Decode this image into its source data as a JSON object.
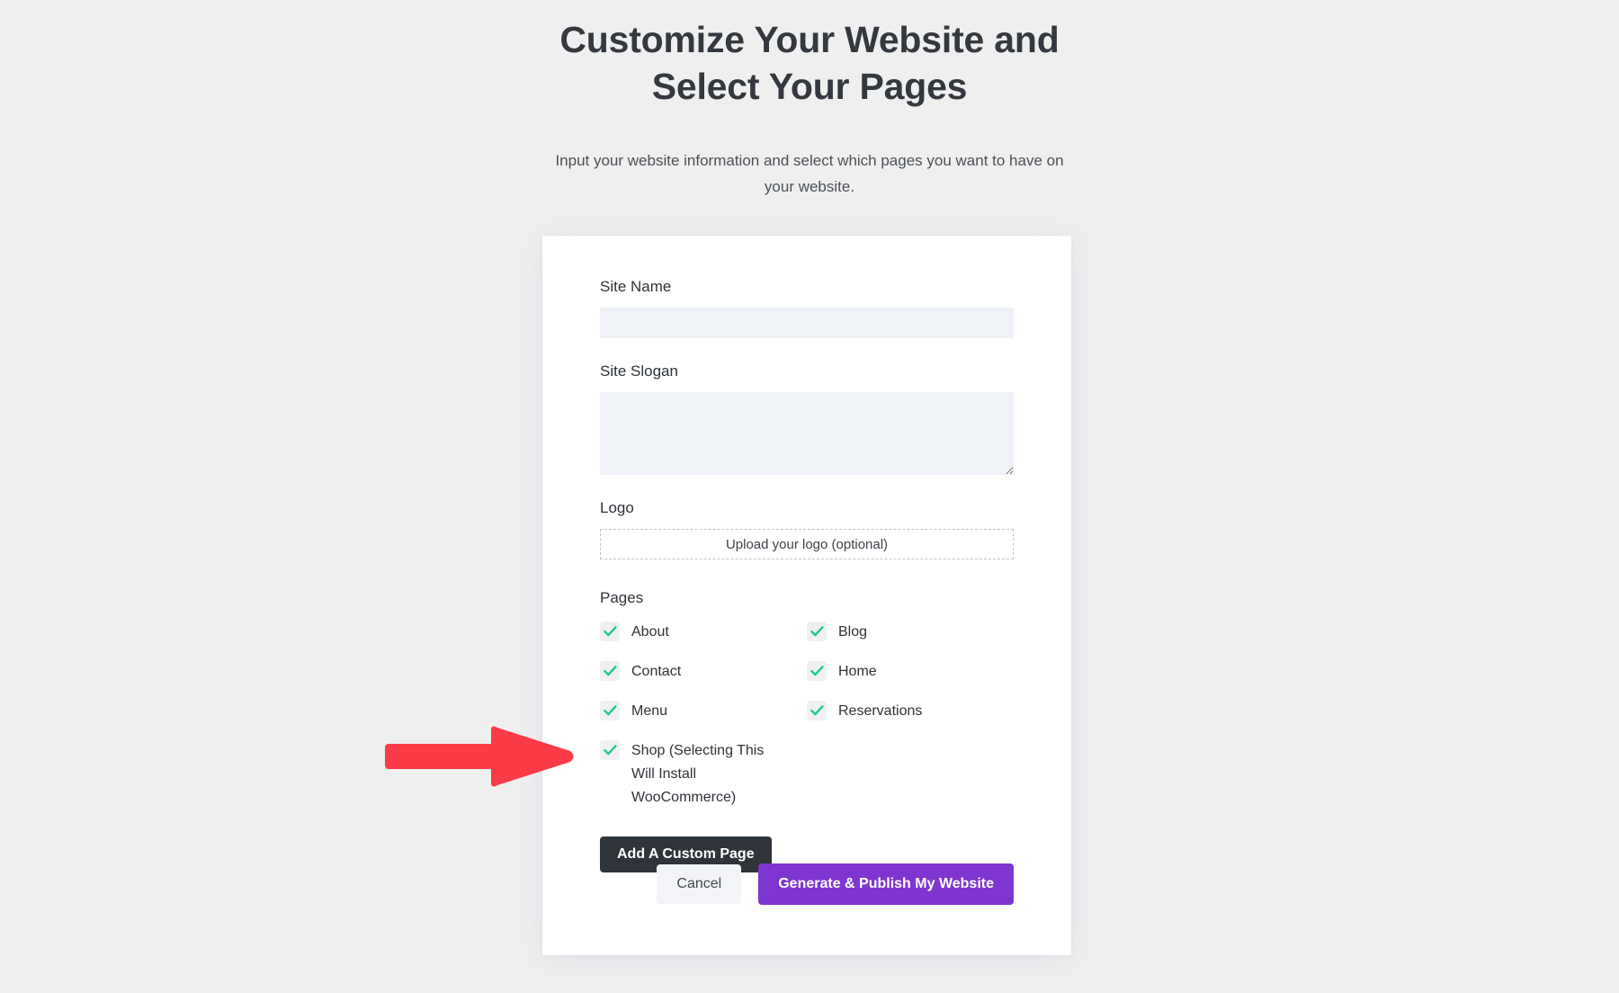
{
  "header": {
    "title": "Customize Your Website and Select Your Pages",
    "subtitle": "Input your website information and select which pages you want to have on your website."
  },
  "form": {
    "site_name": {
      "label": "Site Name",
      "value": "",
      "placeholder": ""
    },
    "site_slogan": {
      "label": "Site Slogan",
      "value": "",
      "placeholder": ""
    },
    "logo": {
      "label": "Logo",
      "upload_text": "Upload your logo (optional)"
    },
    "pages": {
      "label": "Pages",
      "options": [
        {
          "label": "About",
          "checked": true
        },
        {
          "label": "Blog",
          "checked": true
        },
        {
          "label": "Contact",
          "checked": true
        },
        {
          "label": "Home",
          "checked": true
        },
        {
          "label": "Menu",
          "checked": true
        },
        {
          "label": "Reservations",
          "checked": true
        },
        {
          "label": "Shop (Selecting This Will Install WooCommerce)",
          "checked": true
        }
      ]
    },
    "add_custom_page_label": "Add A Custom Page"
  },
  "actions": {
    "cancel_label": "Cancel",
    "publish_label": "Generate & Publish My Website"
  },
  "colors": {
    "page_background": "#efefef",
    "card_background": "#ffffff",
    "input_background": "#eff2f6",
    "checkbox_background": "#f0f0f4",
    "check_green": "#1ec98a",
    "dark_button": "#2f343a",
    "accent_purple": "#7f35cf",
    "annotation_red": "#f93a47",
    "heading_text": "#34393f"
  },
  "annotation": {
    "type": "arrow",
    "direction": "right",
    "points_to": "Shop (Selecting This Will Install WooCommerce)"
  }
}
